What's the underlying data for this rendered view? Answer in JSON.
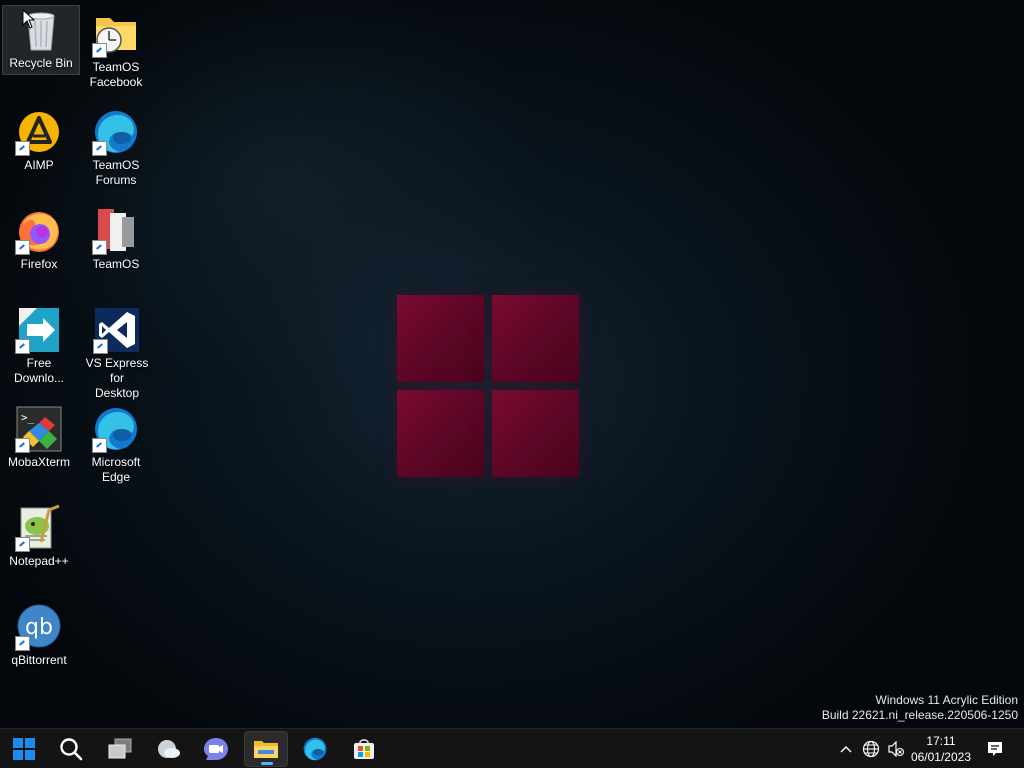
{
  "desktop_icons": [
    {
      "label": "Recycle Bin",
      "icon": "recycle-bin-icon",
      "shortcut": false
    },
    {
      "label": "TeamOS\nFacebook",
      "icon": "folder-clock-icon",
      "shortcut": true
    },
    {
      "label": "AIMP",
      "icon": "aimp-icon",
      "shortcut": true
    },
    {
      "label": "TeamOS\nForums",
      "icon": "edge-icon",
      "shortcut": true
    },
    {
      "label": "Firefox",
      "icon": "firefox-icon",
      "shortcut": true
    },
    {
      "label": "TeamOS",
      "icon": "teamos-icon",
      "shortcut": true
    },
    {
      "label": "Free\nDownlo...",
      "icon": "free-download-manager-icon",
      "shortcut": true
    },
    {
      "label": "VS Express for\nDesktop",
      "icon": "visual-studio-icon",
      "shortcut": true
    },
    {
      "label": "MobaXterm",
      "icon": "mobaxterm-icon",
      "shortcut": true
    },
    {
      "label": "Microsoft\nEdge",
      "icon": "edge-icon",
      "shortcut": true
    },
    {
      "label": "Notepad++",
      "icon": "notepad-plus-plus-icon",
      "shortcut": true
    },
    {
      "label": "qBittorrent",
      "icon": "qbittorrent-icon",
      "shortcut": true
    }
  ],
  "watermark": {
    "line1": "Windows 11 Acrylic Edition",
    "line2": "Build 22621.ni_release.220506-1250"
  },
  "taskbar": {
    "buttons": [
      {
        "name": "start",
        "icon": "windows-start-icon"
      },
      {
        "name": "search",
        "icon": "search-icon"
      },
      {
        "name": "task-view",
        "icon": "task-view-icon"
      },
      {
        "name": "widgets",
        "icon": "weather-widget-icon"
      },
      {
        "name": "chat",
        "icon": "teams-chat-icon"
      },
      {
        "name": "file-explorer",
        "icon": "folder-icon",
        "active": true
      },
      {
        "name": "edge",
        "icon": "edge-icon"
      },
      {
        "name": "store",
        "icon": "store-icon"
      }
    ],
    "tray": {
      "chevron_icon": "chevron-up-icon",
      "network_icon": "globe-network-icon",
      "volume_icon": "volume-muted-icon",
      "time": "17:11",
      "date": "06/01/2023",
      "notification_icon": "notification-icon"
    }
  },
  "colors": {
    "logo": "#6a0828",
    "taskbar": "#141414",
    "accent": "#5fb2f2"
  }
}
